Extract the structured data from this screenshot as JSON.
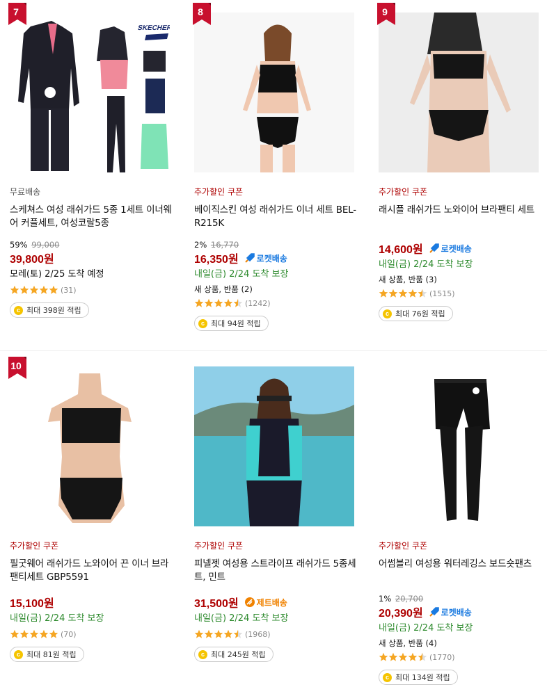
{
  "products": [
    {
      "rank": "7",
      "badge": "무료배송",
      "badge_type": "gray",
      "name": "스케쳐스 여성 래쉬가드 5종 1세트 이너웨어 커플세트, 여성코랄5종",
      "discount": "59%",
      "original_price": "99,000",
      "price": "39,800원",
      "shipping": "",
      "arrival": "모레(토) 2/25 도착 예정",
      "arrival_type": "black",
      "review_summary": "",
      "rating": 5,
      "review_count": "(31)",
      "points": "최대 398원 적립",
      "image": "rashguard-set-icon"
    },
    {
      "rank": "8",
      "badge": "추가할인 쿠폰",
      "badge_type": "red",
      "name": "베이직스킨 여성 래쉬가드 이너 세트 BEL-R215K",
      "discount": "2%",
      "original_price": "16,770",
      "price": "16,350원",
      "shipping": "로켓배송",
      "shipping_type": "rocket",
      "arrival": "내일(금) 2/24 도착 보장",
      "arrival_type": "green",
      "review_summary": "새 상품, 반품 (2)",
      "rating": 4.5,
      "review_count": "(1242)",
      "points": "최대 94원 적립",
      "image": "inner-set-model-icon"
    },
    {
      "rank": "9",
      "badge": "추가할인 쿠폰",
      "badge_type": "red",
      "name": "래시플 래쉬가드 노와이어 브라팬티 세트",
      "discount": "",
      "original_price": "",
      "price": "14,600원",
      "shipping": "로켓배송",
      "shipping_type": "rocket",
      "arrival": "내일(금) 2/24 도착 보장",
      "arrival_type": "green",
      "review_summary": "새 상품, 반품 (3)",
      "rating": 4.5,
      "review_count": "(1515)",
      "points": "최대 76원 적립",
      "image": "bra-panty-model-icon"
    },
    {
      "rank": "10",
      "badge": "추가할인 쿠폰",
      "badge_type": "red",
      "name": "필굿웨어 래쉬가드 노와이어 끈 이너 브라팬티세트 GBP5591",
      "discount": "",
      "original_price": "",
      "price": "15,100원",
      "shipping": "",
      "arrival": "내일(금) 2/24 도착 보장",
      "arrival_type": "green",
      "review_summary": "",
      "rating": 5,
      "review_count": "(70)",
      "points": "최대 81원 적립",
      "image": "mannequin-bra-set-icon"
    },
    {
      "rank": "",
      "badge": "추가할인 쿠폰",
      "badge_type": "red",
      "name": "피넬젯 여성용 스트라이프 래쉬가드 5종세트, 민트",
      "discount": "",
      "original_price": "",
      "price": "31,500원",
      "shipping": "제트배송",
      "shipping_type": "jet",
      "arrival": "내일(금) 2/24 도착 보장",
      "arrival_type": "green",
      "review_summary": "",
      "rating": 4.5,
      "review_count": "(1968)",
      "points": "최대 245원 적립",
      "image": "beach-rashguard-model-icon"
    },
    {
      "rank": "",
      "badge": "추가할인 쿠폰",
      "badge_type": "red",
      "name": "어썸블리 여성용 워터레깅스 보드숏팬츠",
      "discount": "1%",
      "original_price": "20,700",
      "price": "20,390원",
      "shipping": "로켓배송",
      "shipping_type": "rocket",
      "arrival": "내일(금) 2/24 도착 보장",
      "arrival_type": "green",
      "review_summary": "새 상품, 반품 (4)",
      "rating": 4.5,
      "review_count": "(1770)",
      "points": "최대 134원 적립",
      "image": "water-leggings-icon"
    }
  ],
  "colors": {
    "price_red": "#ae0000",
    "arrival_green": "#2d8a2d",
    "rocket_blue": "#1a7ae0",
    "jet_orange": "#f08200",
    "rank_red": "#c8102e",
    "star_orange": "#f5a623"
  }
}
